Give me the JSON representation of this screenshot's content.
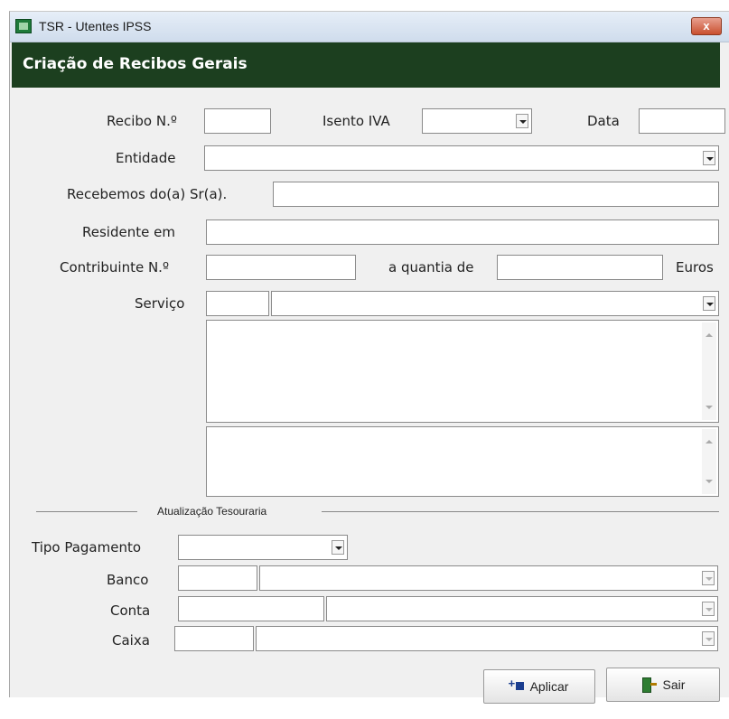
{
  "window": {
    "title": "TSR - Utentes IPSS",
    "close_label": "x"
  },
  "header": {
    "title": "Criação de Recibos Gerais"
  },
  "form": {
    "recibo_label": "Recibo N.º",
    "isento_iva_label": "Isento IVA",
    "data_label": "Data",
    "entidade_label": "Entidade",
    "recebemos_label": "Recebemos do(a) Sr(a).",
    "residente_label": "Residente em",
    "contribuinte_label": "Contribuinte N.º",
    "quantia_label": "a quantia de",
    "euros_label": "Euros",
    "servico_label": "Serviço"
  },
  "tesouraria": {
    "section_label": "Atualização Tesouraria",
    "tipo_pagamento_label": "Tipo Pagamento",
    "banco_label": "Banco",
    "conta_label": "Conta",
    "caixa_label": "Caixa"
  },
  "buttons": {
    "aplicar_label": "Aplicar",
    "sair_label": "Sair"
  },
  "icons": {
    "app": "app-icon",
    "close": "close-icon",
    "dropdown": "chevron-down-icon",
    "aplicar": "add-icon",
    "sair": "exit-door-icon"
  }
}
